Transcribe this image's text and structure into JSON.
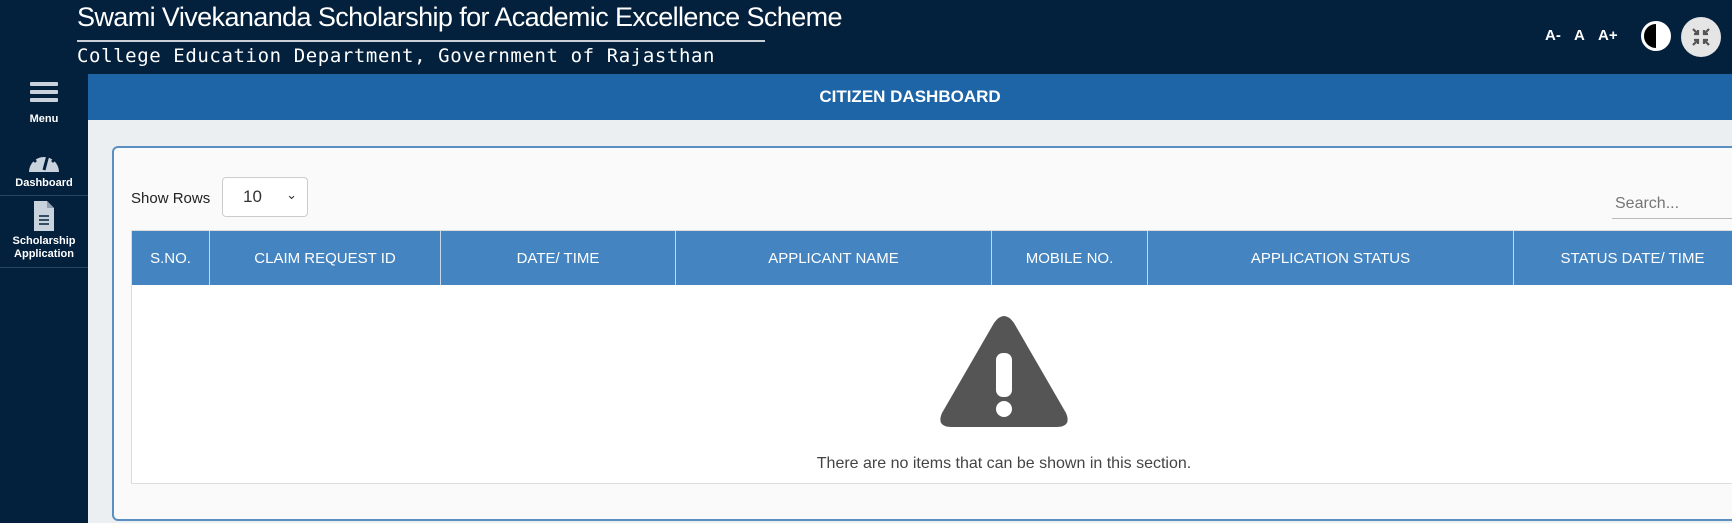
{
  "header": {
    "title": "Swami Vivekananda Scholarship for Academic Excellence Scheme",
    "subtitle": "College Education Department, Government of Rajasthan",
    "font_decrease": "A-",
    "font_normal": "A",
    "font_increase": "A+"
  },
  "sidebar": {
    "items": [
      {
        "label": "Menu",
        "icon": "hamburger-icon"
      },
      {
        "label": "Dashboard",
        "icon": "speedometer-icon"
      },
      {
        "label": "Scholarship Application",
        "icon": "document-icon"
      }
    ]
  },
  "page": {
    "title": "CITIZEN DASHBOARD"
  },
  "table": {
    "show_rows_label": "Show Rows",
    "rows_value": "10",
    "search_placeholder": "Search...",
    "columns": [
      "S.NO.",
      "CLAIM REQUEST ID",
      "DATE/ TIME",
      "APPLICANT NAME",
      "MOBILE NO.",
      "APPLICATION STATUS",
      "STATUS DATE/ TIME"
    ],
    "empty_message": "There are no items that can be shown in this section."
  },
  "colors": {
    "header_bg": "#03203c",
    "title_bar": "#1e65a7",
    "table_header": "#4384c1"
  }
}
